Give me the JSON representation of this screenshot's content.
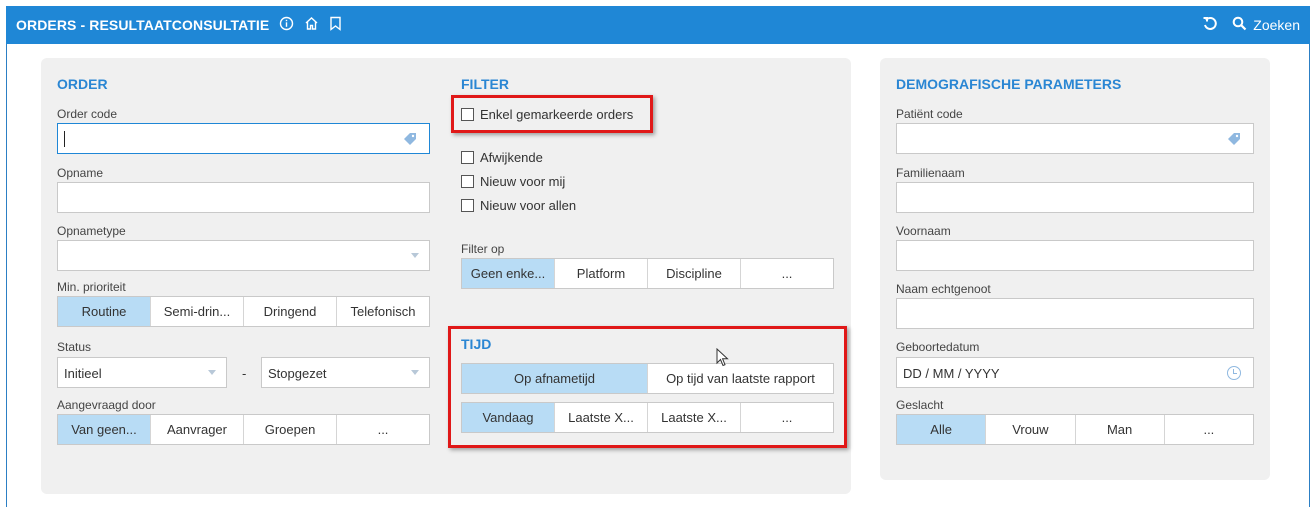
{
  "header": {
    "title": "ORDERS - RESULTAATCONSULTATIE",
    "icons": [
      "info-icon",
      "home-icon",
      "bookmark-icon"
    ],
    "search_label": "Zoeken"
  },
  "order": {
    "title": "ORDER",
    "order_code_label": "Order code",
    "opname_label": "Opname",
    "opnametype_label": "Opnametype",
    "priority_label": "Min. prioriteit",
    "priority_options": [
      "Routine",
      "Semi-drin...",
      "Dringend",
      "Telefonisch"
    ],
    "status_label": "Status",
    "status_from": "Initieel",
    "status_sep": "-",
    "status_to": "Stopgezet",
    "requested_label": "Aangevraagd door",
    "requested_options": [
      "Van geen...",
      "Aanvrager",
      "Groepen",
      "..."
    ]
  },
  "filter": {
    "title": "FILTER",
    "marked_only": "Enkel gemarkeerde orders",
    "afwijkende": "Afwijkende",
    "nieuw_mij": "Nieuw voor mij",
    "nieuw_allen": "Nieuw voor allen",
    "filter_op_label": "Filter op",
    "filter_op_options": [
      "Geen enke...",
      "Platform",
      "Discipline",
      "..."
    ]
  },
  "tijd": {
    "title": "TIJD",
    "mode_options": [
      "Op afnametijd",
      "Op tijd van laatste rapport"
    ],
    "range_options": [
      "Vandaag",
      "Laatste X...",
      "Laatste X...",
      "..."
    ]
  },
  "demo": {
    "title": "DEMOGRAFISCHE PARAMETERS",
    "patient_label": "Patiënt code",
    "family_label": "Familienaam",
    "first_label": "Voornaam",
    "spouse_label": "Naam echtgenoot",
    "birth_label": "Geboortedatum",
    "birth_placeholder": "DD / MM /  YYYY",
    "sex_label": "Geslacht",
    "sex_options": [
      "Alle",
      "Vrouw",
      "Man",
      "..."
    ]
  },
  "colors": {
    "header_bg": "#1f87d6",
    "accent": "#2a86d3",
    "selected_bg": "#b8dcf5",
    "highlight": "#e01818"
  }
}
